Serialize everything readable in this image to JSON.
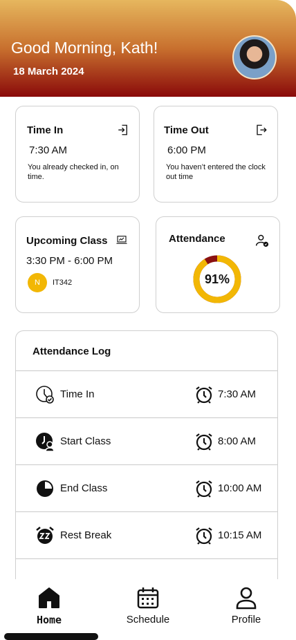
{
  "header": {
    "greeting": "Good Morning, Kath!",
    "date": "18 March 2024",
    "gradient": [
      "#e6b75e",
      "#c8702e",
      "#8a0a0a"
    ]
  },
  "time_in": {
    "title": "Time In",
    "value": "7:30 AM",
    "note": "You already checked in, on time.",
    "icon": "log-in-icon"
  },
  "time_out": {
    "title": "Time Out",
    "value": "6:00 PM",
    "note": "You haven’t entered the clock out time",
    "icon": "log-out-icon"
  },
  "upcoming": {
    "title": "Upcoming Class",
    "time": "3:30 PM - 6:00 PM",
    "badge": "N",
    "course": "IT342",
    "icon": "laptop-icon",
    "badge_color": "#f2b705"
  },
  "attendance": {
    "title": "Attendance",
    "percent_label": "91%",
    "percent": 91,
    "icon": "user-check-icon",
    "ring_color": "#f2b705",
    "remainder_color": "#8a1111"
  },
  "log": {
    "title": "Attendance Log",
    "rows": [
      {
        "label": "Time In",
        "time": "7:30 AM",
        "icon": "clock-check-icon"
      },
      {
        "label": "Start Class",
        "time": "8:00 AM",
        "icon": "teacher-icon"
      },
      {
        "label": "End Class",
        "time": "10:00 AM",
        "icon": "pie-clock-icon"
      },
      {
        "label": "Rest Break",
        "time": "10:15 AM",
        "icon": "snooze-alarm-icon"
      }
    ]
  },
  "nav": {
    "home": "Home",
    "schedule": "Schedule",
    "profile": "Profile"
  }
}
